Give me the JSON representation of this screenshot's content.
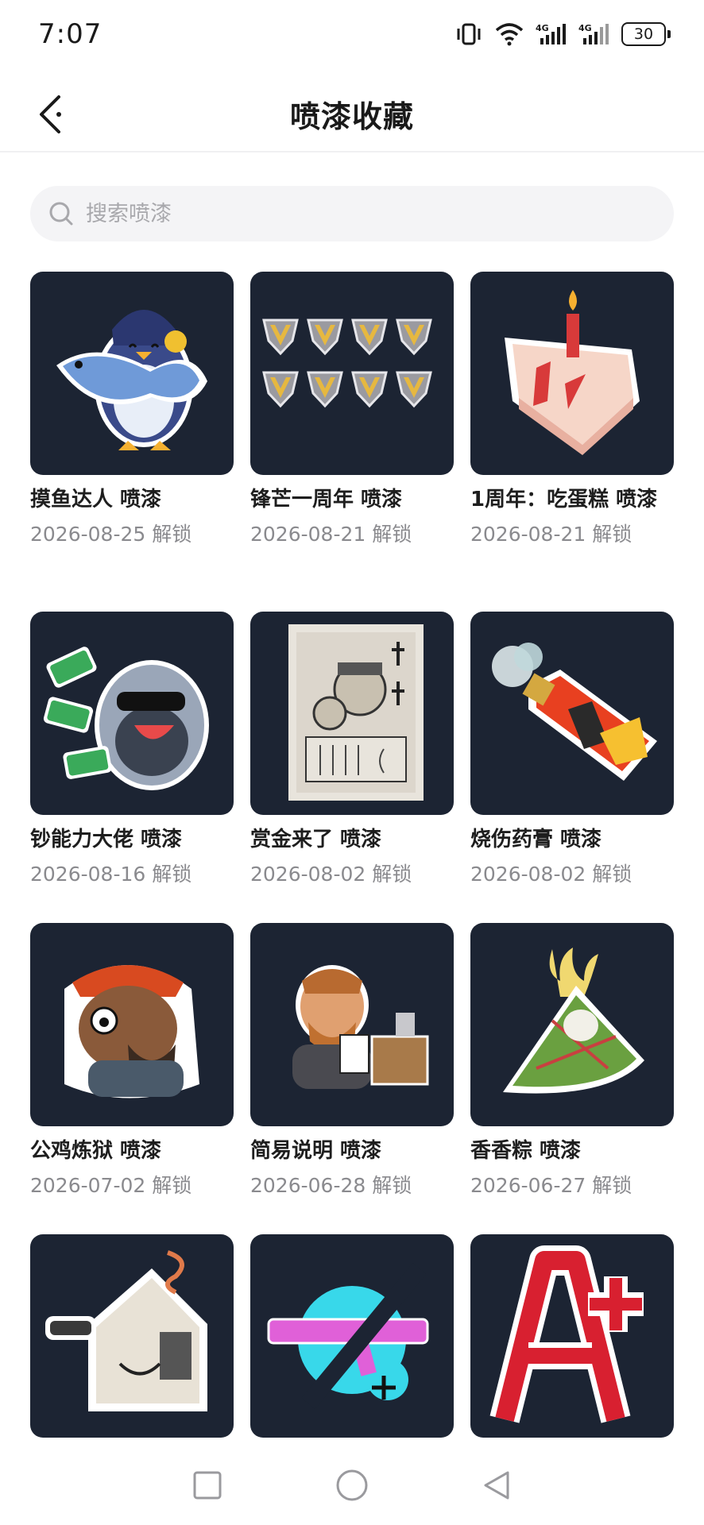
{
  "status_bar": {
    "time": "7:07",
    "battery": "30",
    "network_label_1": "4G",
    "network_label_2": "4G"
  },
  "header": {
    "title": "喷漆收藏"
  },
  "search": {
    "placeholder": "搜索喷漆"
  },
  "colors": {
    "thumb_bg": "#1c2433",
    "title": "#1e1e1e",
    "date": "#8a8a8e"
  },
  "sprays": [
    {
      "title": "摸鱼达人 喷漆",
      "date": "2026-08-25 解锁",
      "icon": "penguin-fish-icon"
    },
    {
      "title": "锋芒一周年 喷漆",
      "date": "2026-08-21 解锁",
      "icon": "anniversary-badges-icon"
    },
    {
      "title": "1周年：吃蛋糕 喷漆",
      "date": "2026-08-21 解锁",
      "icon": "cake-icon"
    },
    {
      "title": "钞能力大佬 喷漆",
      "date": "2026-08-16 解锁",
      "icon": "money-sloth-icon"
    },
    {
      "title": "赏金来了 喷漆",
      "date": "2026-08-02 解锁",
      "icon": "wanted-poster-icon"
    },
    {
      "title": "烧伤药膏 喷漆",
      "date": "2026-08-02 解锁",
      "icon": "burn-ointment-icon"
    },
    {
      "title": "公鸡炼狱 喷漆",
      "date": "2026-07-02 解锁",
      "icon": "rooster-agent-icon"
    },
    {
      "title": "简易说明 喷漆",
      "date": "2026-06-28 解锁",
      "icon": "manual-agent-icon"
    },
    {
      "title": "香香粽 喷漆",
      "date": "2026-06-27 解锁",
      "icon": "zongzi-icon"
    },
    {
      "title": "",
      "date": "",
      "icon": "house-binoculars-icon"
    },
    {
      "title": "",
      "date": "",
      "icon": "crossed-gun-icon"
    },
    {
      "title": "",
      "date": "",
      "icon": "a-plus-icon"
    }
  ]
}
